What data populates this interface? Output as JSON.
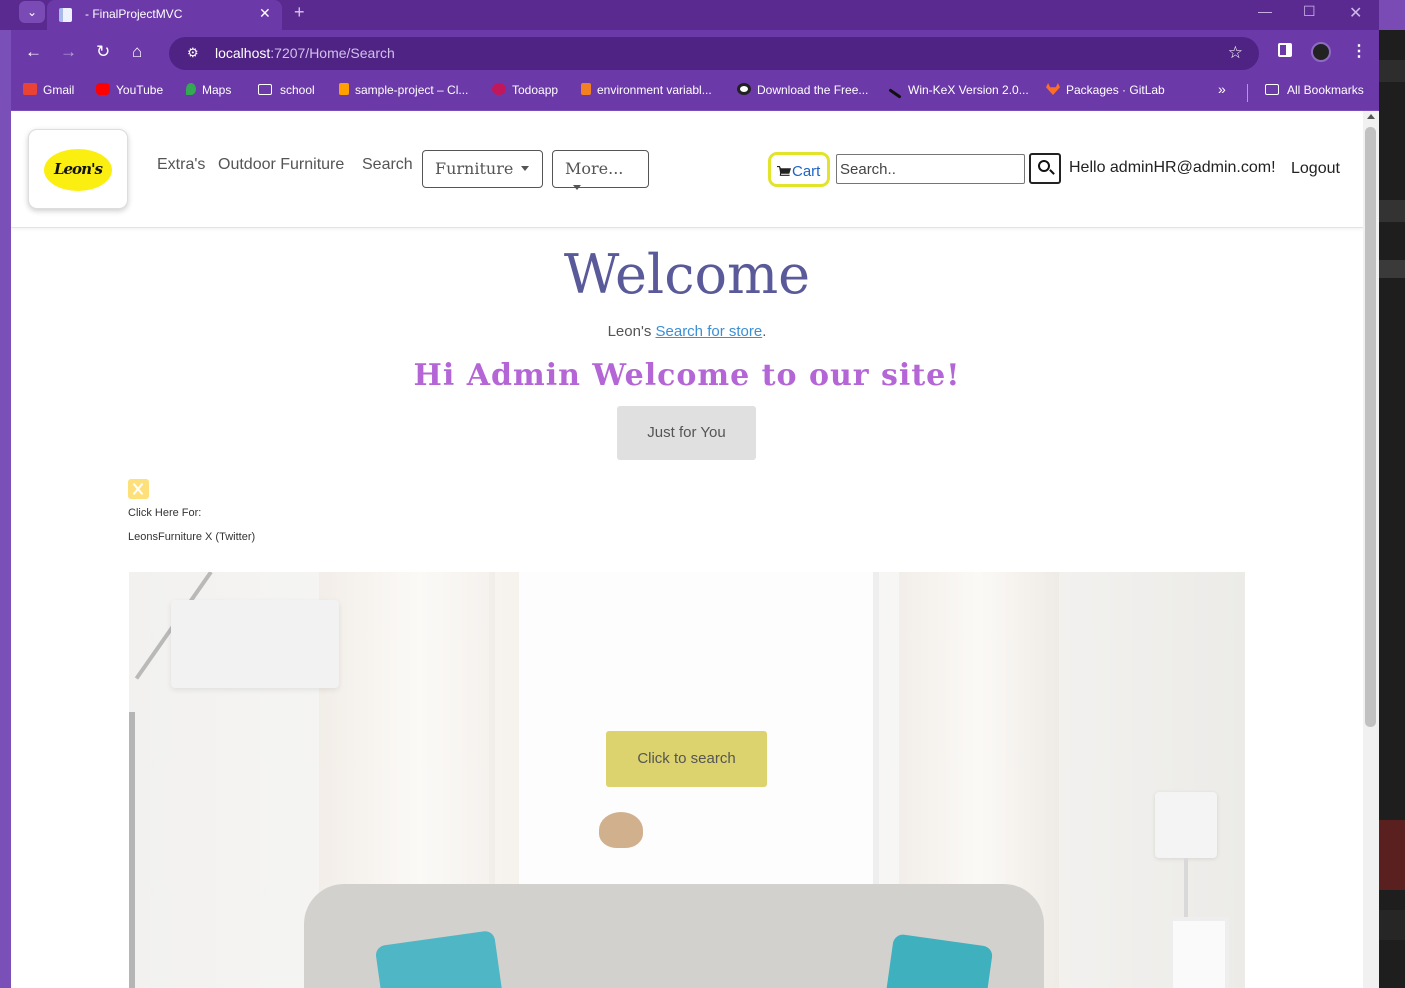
{
  "browser": {
    "tab_title": "- FinalProjectMVC",
    "url_host": "localhost",
    "url_rest": ":7207/Home/Search",
    "bookmarks": [
      {
        "label": "Gmail",
        "icon": "gmail-icon",
        "color": "#ea4335"
      },
      {
        "label": "YouTube",
        "icon": "youtube-icon",
        "color": "#ff0000"
      },
      {
        "label": "Maps",
        "icon": "maps-icon",
        "color": "#34a853"
      },
      {
        "label": "school",
        "icon": "folder-icon",
        "color": ""
      },
      {
        "label": "sample-project – Cl...",
        "icon": "firebase-icon",
        "color": "#ffa000"
      },
      {
        "label": "Todoapp",
        "icon": "todoapp-icon",
        "color": "#c2185b"
      },
      {
        "label": "environment variabl...",
        "icon": "stackoverflow-icon",
        "color": "#f48024"
      },
      {
        "label": "Download the Free...",
        "icon": "eye-icon",
        "color": "#ffffff"
      },
      {
        "label": "Win-KeX Version 2.0...",
        "icon": "kali-icon",
        "color": "#111111"
      },
      {
        "label": "Packages · GitLab",
        "icon": "gitlab-icon",
        "color": "#fc6d26"
      }
    ],
    "all_bookmarks": "All Bookmarks"
  },
  "navbar": {
    "logo_text": "Leon's",
    "links": [
      "Extra's",
      "Outdoor Furniture",
      "Search"
    ],
    "dropdown_furniture": "Furniture",
    "dropdown_more": "More...",
    "cart": "Cart",
    "search_placeholder": "Search..",
    "hello": "Hello adminHR@admin.com!",
    "logout": "Logout"
  },
  "main": {
    "title": "Welcome",
    "sub_prefix": "Leon's ",
    "sub_link": "Search for store",
    "sub_suffix": ".",
    "greeting": "Hi Admin Welcome to our site!",
    "just_for_you": "Just for You",
    "click_here": "Click Here For:",
    "twitter_link": "LeonsFurniture X (Twitter)",
    "click_to_search": "Click to search"
  },
  "colors": {
    "browser_frame": "#6b3aa8",
    "welcome_title": "#5a5a9a",
    "greeting": "#b465d6",
    "cart_outline": "#e1e42a",
    "search_button_bg": "#dcd36f",
    "logo_yellow": "#fbef12"
  }
}
